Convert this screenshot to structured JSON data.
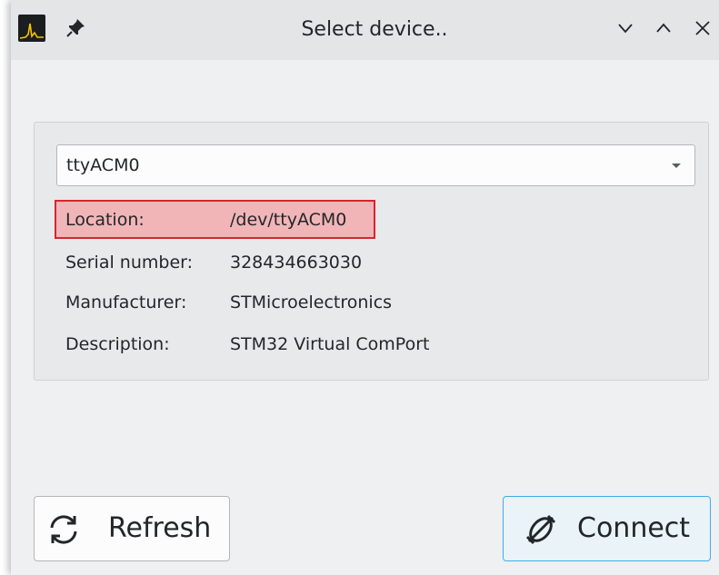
{
  "window": {
    "title": "Select device..",
    "icons": {
      "app": "oscilloscope-app-icon",
      "pin": "pin-icon",
      "minimize": "chevron-down-icon",
      "maximize": "chevron-up-icon",
      "close": "close-icon"
    }
  },
  "device_select": {
    "selected": "ttyACM0",
    "arrow_icon": "dropdown-arrow-icon"
  },
  "details": [
    {
      "key": "Location:",
      "value": "/dev/ttyACM0",
      "highlighted": true
    },
    {
      "key": "Serial number:",
      "value": "328434663030"
    },
    {
      "key": "Manufacturer:",
      "value": "STMicroelectronics"
    },
    {
      "key": "Description:",
      "value": "STM32 Virtual ComPort"
    }
  ],
  "buttons": {
    "refresh": {
      "label": "Refresh",
      "icon": "refresh-icon"
    },
    "connect": {
      "label": "Connect",
      "icon": "plug-disconnected-icon"
    }
  },
  "colors": {
    "highlight_fill": "#f1b5b8",
    "highlight_border": "#d8242f",
    "accent": "#3daee9"
  }
}
